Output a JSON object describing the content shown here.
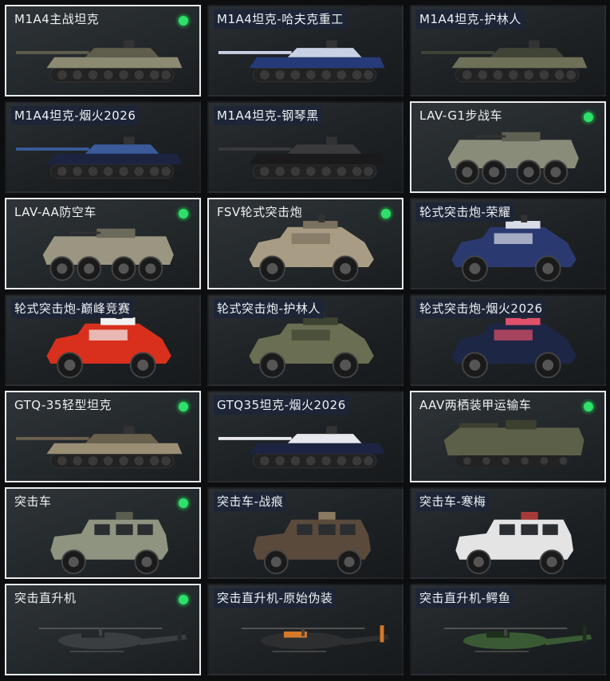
{
  "vehicles": [
    {
      "name": "M1A4主战坦克",
      "owned": true,
      "kind": "tank",
      "color": "#8c8a72",
      "accent": "#5f5d4c",
      "icon": "tank-icon"
    },
    {
      "name": "M1A4坦克-哈夫克重工",
      "owned": false,
      "kind": "tank",
      "color": "#263a78",
      "accent": "#c9d2e4",
      "icon": "tank-icon"
    },
    {
      "name": "M1A4坦克-护林人",
      "owned": false,
      "kind": "tank",
      "color": "#6f7058",
      "accent": "#3f4436",
      "icon": "tank-icon"
    },
    {
      "name": "M1A4坦克-烟火2026",
      "owned": false,
      "kind": "tank",
      "color": "#1c2440",
      "accent": "#3a5a9a",
      "icon": "tank-icon"
    },
    {
      "name": "M1A4坦克-钢琴黑",
      "owned": false,
      "kind": "tank",
      "color": "#1a1a1c",
      "accent": "#3a3a3c",
      "icon": "tank-icon"
    },
    {
      "name": "LAV-G1步战车",
      "owned": true,
      "kind": "apc",
      "color": "#8a8c7a",
      "accent": "#5e6052",
      "icon": "armored-vehicle-icon"
    },
    {
      "name": "LAV-AA防空车",
      "owned": true,
      "kind": "apc",
      "color": "#9a9682",
      "accent": "#6c6a5a",
      "icon": "armored-vehicle-icon"
    },
    {
      "name": "FSV轮式突击炮",
      "owned": true,
      "kind": "fsv",
      "color": "#a89c84",
      "accent": "#7a705e",
      "icon": "armored-vehicle-icon"
    },
    {
      "name": "轮式突击炮-荣耀",
      "owned": false,
      "kind": "fsv",
      "color": "#2a3a70",
      "accent": "#d8dce6",
      "icon": "armored-vehicle-icon"
    },
    {
      "name": "轮式突击炮-巅峰竞赛",
      "owned": false,
      "kind": "fsv",
      "color": "#d8301c",
      "accent": "#f2f2f2",
      "icon": "armored-vehicle-icon"
    },
    {
      "name": "轮式突击炮-护林人",
      "owned": false,
      "kind": "fsv",
      "color": "#6a6e52",
      "accent": "#3e4432",
      "icon": "armored-vehicle-icon"
    },
    {
      "name": "轮式突击炮-烟火2026",
      "owned": false,
      "kind": "fsv",
      "color": "#1e2646",
      "accent": "#e0506a",
      "icon": "armored-vehicle-icon"
    },
    {
      "name": "GTQ-35轻型坦克",
      "owned": true,
      "kind": "tank",
      "color": "#9a8e74",
      "accent": "#6a604e",
      "icon": "tank-icon"
    },
    {
      "name": "GTQ35坦克-烟火2026",
      "owned": false,
      "kind": "tank",
      "color": "#1c2442",
      "accent": "#e6e8ee",
      "icon": "tank-icon"
    },
    {
      "name": "AAV两栖装甲运输车",
      "owned": true,
      "kind": "aav",
      "color": "#5c6048",
      "accent": "#3c402f",
      "icon": "amphibious-vehicle-icon"
    },
    {
      "name": "突击车",
      "owned": true,
      "kind": "mrap",
      "color": "#8e9480",
      "accent": "#5a5e50",
      "icon": "assault-vehicle-icon"
    },
    {
      "name": "突击车-战痕",
      "owned": false,
      "kind": "mrap",
      "color": "#5a4a3c",
      "accent": "#8a7a62",
      "icon": "assault-vehicle-icon"
    },
    {
      "name": "突击车-寒梅",
      "owned": false,
      "kind": "mrap",
      "color": "#e4e4e4",
      "accent": "#a83a3a",
      "icon": "assault-vehicle-icon"
    },
    {
      "name": "突击直升机",
      "owned": true,
      "kind": "heli",
      "color": "#3a3e40",
      "accent": "#24282a",
      "icon": "helicopter-icon"
    },
    {
      "name": "突击直升机-原始伪装",
      "owned": false,
      "kind": "heli",
      "color": "#2c2e30",
      "accent": "#d6782a",
      "icon": "helicopter-icon"
    },
    {
      "name": "突击直升机-鳄鱼",
      "owned": false,
      "kind": "heli",
      "color": "#3a5a34",
      "accent": "#1e301c",
      "icon": "helicopter-icon"
    }
  ]
}
